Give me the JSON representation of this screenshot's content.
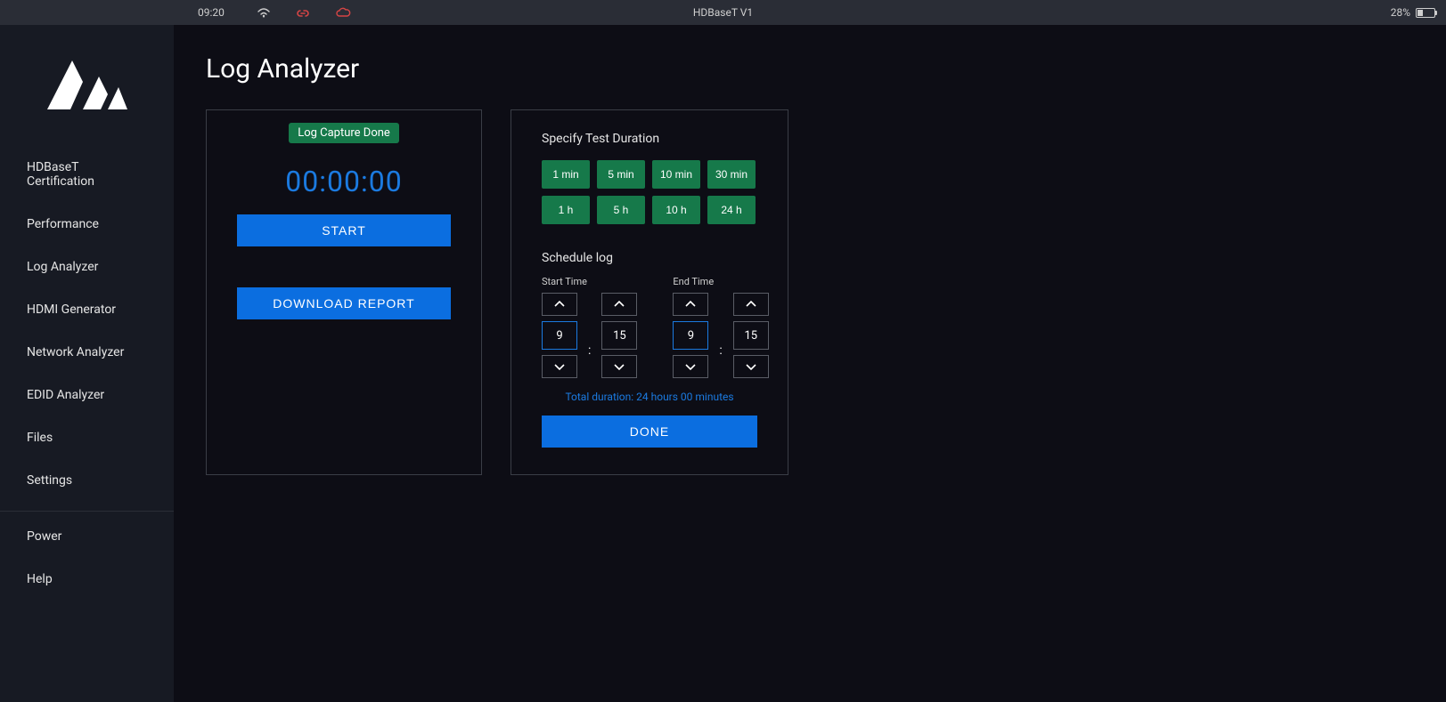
{
  "statusbar": {
    "time": "09:20",
    "title": "HDBaseT V1",
    "battery_pct": "28%"
  },
  "sidebar": {
    "items": [
      "HDBaseT Certification",
      "Performance",
      "Log Analyzer",
      "HDMI Generator",
      "Network Analyzer",
      "EDID Analyzer",
      "Files",
      "Settings"
    ],
    "footer_items": [
      "Power",
      "Help"
    ]
  },
  "page": {
    "title": "Log Analyzer"
  },
  "capture": {
    "status": "Log Capture Done",
    "timer": "00:00:00",
    "start_label": "START",
    "download_label": "DOWNLOAD REPORT"
  },
  "duration": {
    "heading": "Specify Test Duration",
    "options": [
      "1 min",
      "5 min",
      "10 min",
      "30 min",
      "1 h",
      "5 h",
      "10 h",
      "24 h"
    ]
  },
  "schedule": {
    "heading": "Schedule log",
    "start_label": "Start Time",
    "end_label": "End Time",
    "start_h": "9",
    "start_m": "15",
    "end_h": "9",
    "end_m": "15",
    "total": "Total duration: 24 hours 00 minutes",
    "done_label": "DONE"
  }
}
